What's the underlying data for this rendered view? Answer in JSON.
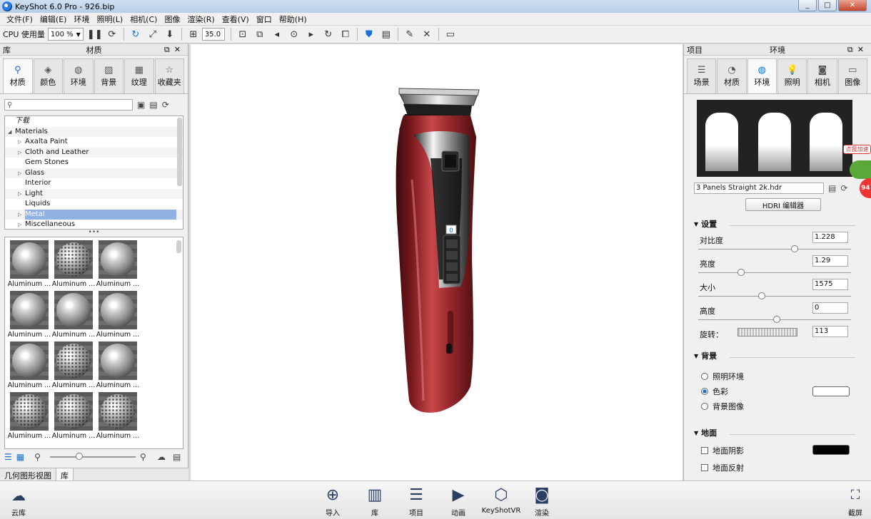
{
  "app": {
    "title": "KeyShot 6.0 Pro  - 926.bip"
  },
  "window": {
    "min": "_",
    "max": "□",
    "close": "✕"
  },
  "menu": [
    "文件(F)",
    "编辑(E)",
    "环境",
    "照明(L)",
    "相机(C)",
    "图像",
    "渲染(R)",
    "查看(V)",
    "窗口",
    "帮助(H)"
  ],
  "toolbar": {
    "cpu_label": "CPU 使用量",
    "cpu_value": "100 %",
    "focal_value": "35.0"
  },
  "left_panel": {
    "lib_label": "库",
    "title": "材质",
    "tabs": [
      "材质",
      "颜色",
      "环境",
      "背景",
      "纹理",
      "收藏夹"
    ],
    "search_placeholder": "",
    "tree": {
      "items": [
        {
          "label": "下载",
          "expand": "",
          "indent": 0
        },
        {
          "label": "Materials",
          "expand": "◢",
          "indent": 0
        },
        {
          "label": "Axalta Paint",
          "expand": "▷",
          "indent": 1
        },
        {
          "label": "Cloth and Leather",
          "expand": "▷",
          "indent": 1
        },
        {
          "label": "Gem Stones",
          "expand": "",
          "indent": 1
        },
        {
          "label": "Glass",
          "expand": "▷",
          "indent": 1
        },
        {
          "label": "Interior",
          "expand": "",
          "indent": 1
        },
        {
          "label": "Light",
          "expand": "▷",
          "indent": 1
        },
        {
          "label": "Liquids",
          "expand": "",
          "indent": 1
        },
        {
          "label": "Metal",
          "expand": "▷",
          "indent": 1,
          "selected": true
        },
        {
          "label": "Miscellaneous",
          "expand": "▷",
          "indent": 1
        }
      ]
    },
    "thumbnails": [
      {
        "label": "Aluminum ...",
        "type": "brushed"
      },
      {
        "label": "Aluminum ...",
        "type": "perforated"
      },
      {
        "label": "Aluminum ...",
        "type": "brushed"
      },
      {
        "label": "Aluminum ...",
        "type": "brushed"
      },
      {
        "label": "Aluminum ...",
        "type": "brushed"
      },
      {
        "label": "Aluminum ...",
        "type": "brushed"
      },
      {
        "label": "Aluminum ...",
        "type": "brushed"
      },
      {
        "label": "Aluminum ...",
        "type": "perforated"
      },
      {
        "label": "Aluminum ...",
        "type": "brushed"
      },
      {
        "label": "Aluminum ...",
        "type": "perforated"
      },
      {
        "label": "Aluminum ...",
        "type": "perforated"
      },
      {
        "label": "Aluminum ...",
        "type": "perforated"
      }
    ],
    "bottom_tabs": [
      "几何图形视图",
      "库"
    ]
  },
  "right_panel": {
    "project_label": "项目",
    "title": "环境",
    "tabs": [
      "场景",
      "材质",
      "环境",
      "照明",
      "相机",
      "图像"
    ],
    "hdri_file": "3 Panels Straight 2k.hdr",
    "hdri_editor_button": "HDRI 编辑器",
    "settings": {
      "header": "设置",
      "props": [
        {
          "label": "对比度",
          "value": "1.228",
          "slider": 0.62
        },
        {
          "label": "亮度",
          "value": "1.29",
          "slider": 0.26
        },
        {
          "label": "大小",
          "value": "1575",
          "slider": 0.4
        },
        {
          "label": "高度",
          "value": "0",
          "slider": 0.5
        }
      ],
      "rotation": {
        "label": "旋转：",
        "value": "113"
      }
    },
    "background": {
      "header": "背景",
      "options": [
        {
          "label": "照明环境",
          "checked": false
        },
        {
          "label": "色彩",
          "checked": true
        },
        {
          "label": "背景图像",
          "checked": false
        }
      ],
      "color": "#ffffff"
    },
    "ground": {
      "header": "地面",
      "shadow_label": "地面阴影",
      "shadow_color": "#000000",
      "reflection_label": "地面反射"
    }
  },
  "viewport": {
    "counter": "0"
  },
  "dock": {
    "items": [
      {
        "label": "导入",
        "icon": "import-icon"
      },
      {
        "label": "库",
        "icon": "book-icon"
      },
      {
        "label": "项目",
        "icon": "project-icon"
      },
      {
        "label": "动画",
        "icon": "play-icon"
      },
      {
        "label": "KeyShotVR",
        "icon": "vr-cube-icon"
      },
      {
        "label": "渲染",
        "icon": "render-icon"
      }
    ],
    "cloud_label": "云库",
    "screenshot_label": "截屏"
  },
  "overlay": {
    "tag": "点我加速",
    "badge": "94"
  }
}
